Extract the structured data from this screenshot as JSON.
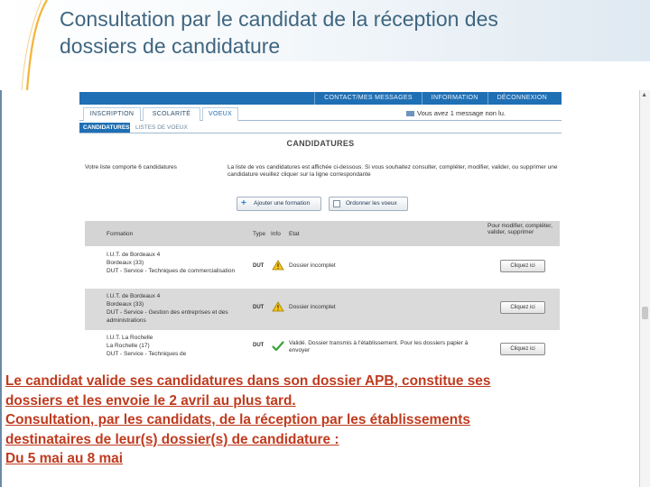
{
  "slide": {
    "title_line1": "Consultation par le candidat de la réception des",
    "title_line2": "dossiers de candidature"
  },
  "topnav": [
    "CONTACT/MES MESSAGES",
    "INFORMATION",
    "DÉCONNEXION"
  ],
  "tabs": [
    "INSCRIPTION",
    "SCOLARITÉ",
    "VOEUX"
  ],
  "message_note": "Vous avez 1 message non lu.",
  "subtabs": [
    "CANDIDATURES",
    "LISTES DE VOEUX"
  ],
  "page_title": "CANDIDATURES",
  "count_text": "Votre liste comporte 6 candidatures",
  "info_text": "La liste de vos candidatures est affichée ci-dessous. Si vous souhaitez consulter, compléter, modifier, valider, ou supprimer une candidature veuillez cliquer sur la ligne correspondante",
  "buttons": {
    "add": "Ajouter une formation",
    "order": "Ordonner les voeux"
  },
  "table": {
    "headers": {
      "formation": "Formation",
      "type": "Type",
      "info": "Info",
      "etat": "Etat",
      "action": "Pour modifier, compléter, valider, supprimer"
    },
    "rows": [
      {
        "formation": "I.U.T. de Bordeaux 4\nBordeaux (33)\nDUT - Service - Techniques de commercialisation",
        "type": "DUT",
        "status_icon": "warning-icon",
        "etat": "Dossier incomplet",
        "button": "Cliquez ici"
      },
      {
        "formation": "I.U.T. de Bordeaux 4\nBordeaux (33)\nDUT - Service - Gestion des entreprises et des administrations",
        "type": "DUT",
        "status_icon": "warning-icon",
        "etat": "Dossier incomplet",
        "button": "Cliquez ici"
      },
      {
        "formation": "I.U.T. La Rochelle\nLa Rochelle (17)\nDUT - Service - Techniques de",
        "type": "DUT",
        "status_icon": "check-icon",
        "etat": "Validé. Dossier transmis à l'établissement. Pour les dossiers papier à envoyer",
        "button": "Cliquez ici"
      }
    ]
  },
  "caption": {
    "line1": "Le candidat valide ses candidatures dans son dossier APB, constitue ses",
    "line2": "dossiers et les envoie le 2 avril au plus tard.",
    "line3": "Consultation, par les candidats, de la réception par les établissements",
    "line4": "destinataires de leur(s) dossier(s) de candidature :",
    "line5": "Du 5 mai au 8 mai"
  },
  "colors": {
    "title": "#3f6680",
    "topbar": "#1f6fb4",
    "caption": "#c03a1e",
    "warning": "#f5c518",
    "check": "#3aa03a"
  }
}
